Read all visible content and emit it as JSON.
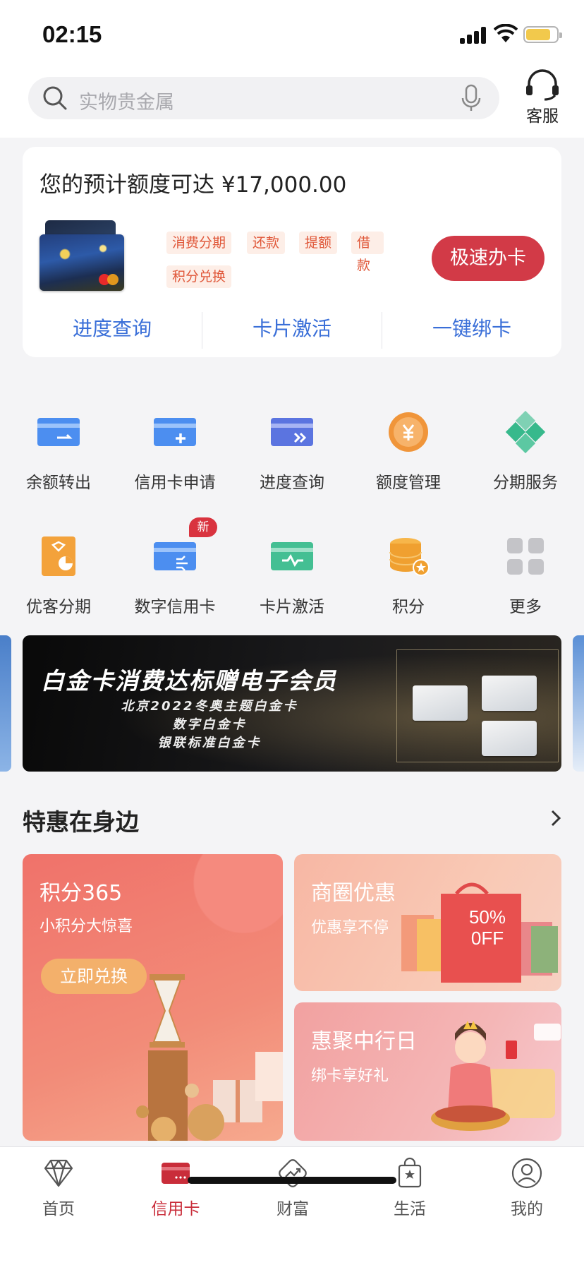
{
  "status_bar": {
    "time": "02:15"
  },
  "header": {
    "search_placeholder": "实物贵金属",
    "service_label": "客服"
  },
  "credit_panel": {
    "title": "您的预计额度可达 ¥17,000.00",
    "tags": [
      "消费分期",
      "还款",
      "提额",
      "借款",
      "积分兑换"
    ],
    "apply_button": "极速办卡",
    "quick_links": [
      "进度查询",
      "卡片激活",
      "一键绑卡"
    ]
  },
  "services": [
    {
      "label": "余额转出",
      "icon": "balance-transfer-icon"
    },
    {
      "label": "信用卡申请",
      "icon": "card-apply-icon"
    },
    {
      "label": "进度查询",
      "icon": "progress-query-icon"
    },
    {
      "label": "额度管理",
      "icon": "limit-management-icon"
    },
    {
      "label": "分期服务",
      "icon": "installment-service-icon"
    },
    {
      "label": "优客分期",
      "icon": "youke-installment-icon"
    },
    {
      "label": "数字信用卡",
      "icon": "digital-card-icon"
    },
    {
      "label": "卡片激活",
      "icon": "card-activate-icon"
    },
    {
      "label": "积分",
      "icon": "points-icon"
    },
    {
      "label": "更多",
      "icon": "more-grid-icon"
    }
  ],
  "new_badge": "新",
  "banner": {
    "title": "白金卡消费达标赠电子会员",
    "lines": [
      "北京2022冬奥主题白金卡",
      "数字白金卡",
      "银联标准白金卡"
    ]
  },
  "offers": {
    "section_title": "特惠在身边",
    "points": {
      "title": "积分365",
      "subtitle": "小积分大惊喜",
      "button": "立即兑换"
    },
    "business": {
      "title": "商圈优惠",
      "subtitle": "优惠享不停",
      "bag_line1": "50%",
      "bag_line2": "0FF"
    },
    "boc_day": {
      "title": "惠聚中行日",
      "subtitle": "绑卡享好礼"
    }
  },
  "tab_bar": [
    {
      "label": "首页",
      "icon": "diamond-icon",
      "active": false
    },
    {
      "label": "信用卡",
      "icon": "credit-card-icon",
      "active": true
    },
    {
      "label": "财富",
      "icon": "wealth-chart-icon",
      "active": false
    },
    {
      "label": "生活",
      "icon": "shopping-bag-icon",
      "active": false
    },
    {
      "label": "我的",
      "icon": "user-profile-icon",
      "active": false
    }
  ],
  "colors": {
    "brand_red": "#d23a47",
    "link_blue": "#3a6fd8",
    "tag_orange": "#e0583a"
  }
}
